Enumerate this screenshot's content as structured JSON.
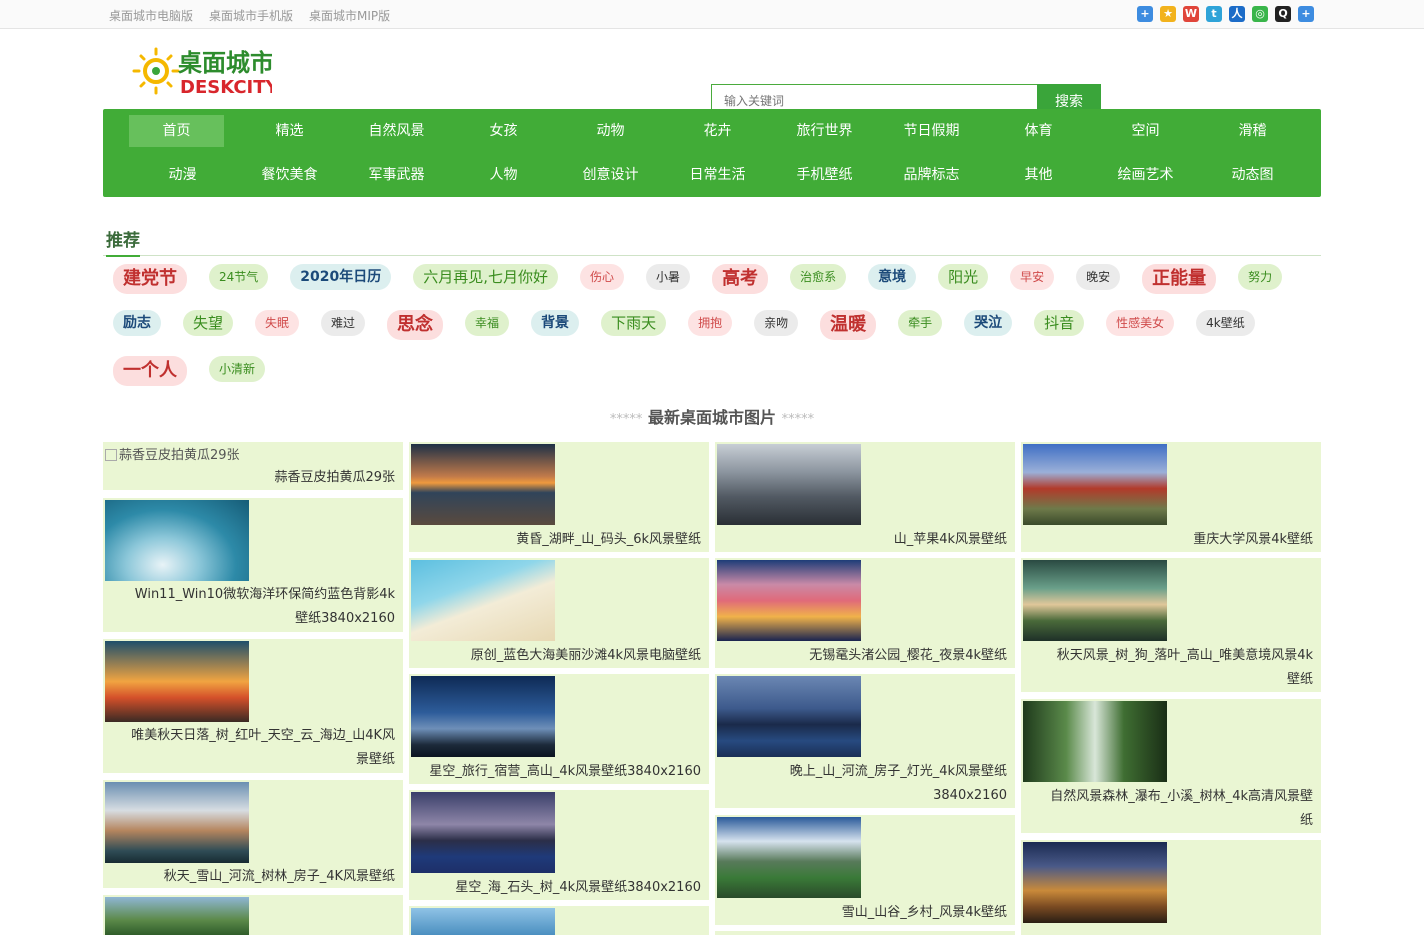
{
  "topbar": {
    "links": [
      "桌面城市电脑版",
      "桌面城市手机版",
      "桌面城市MIP版"
    ],
    "share_icons": [
      "plus-share-icon",
      "qzone-icon",
      "weibo-icon",
      "tencent-weibo-icon",
      "renren-icon",
      "wechat-icon",
      "qq-icon",
      "more-share-icon"
    ]
  },
  "logo": {
    "text_top": "桌面城市",
    "text_bottom": "DESKCITY"
  },
  "search": {
    "placeholder": "输入关键词",
    "button": "搜索"
  },
  "nav": {
    "row1": [
      "首页",
      "精选",
      "自然风景",
      "女孩",
      "动物",
      "花卉",
      "旅行世界",
      "节日假期",
      "体育",
      "空间",
      "滑稽"
    ],
    "row2": [
      "动漫",
      "餐饮美食",
      "军事武器",
      "人物",
      "创意设计",
      "日常生活",
      "手机壁纸",
      "品牌标志",
      "其他",
      "绘画艺术",
      "动态图"
    ]
  },
  "recommend": {
    "title": "推荐",
    "tags": [
      {
        "text": "建党节",
        "style": "t-red t-lg"
      },
      {
        "text": "24节气",
        "style": "t-green t-sm"
      },
      {
        "text": "2020年日历",
        "style": "t-blue t-md"
      },
      {
        "text": "六月再见,七月你好",
        "style": "t-green t-mdn"
      },
      {
        "text": "伤心",
        "style": "t-pink t-sm"
      },
      {
        "text": "小暑",
        "style": "t-grey t-sm"
      },
      {
        "text": "高考",
        "style": "t-red t-lg"
      },
      {
        "text": "治愈系",
        "style": "t-green t-sm"
      },
      {
        "text": "意境",
        "style": "t-blue t-md"
      },
      {
        "text": "阳光",
        "style": "t-green t-mdn"
      },
      {
        "text": "早安",
        "style": "t-pink t-sm"
      },
      {
        "text": "晚安",
        "style": "t-grey t-sm"
      },
      {
        "text": "正能量",
        "style": "t-red t-lg"
      },
      {
        "text": "努力",
        "style": "t-green t-sm"
      },
      {
        "text": "励志",
        "style": "t-blue t-md"
      },
      {
        "text": "失望",
        "style": "t-green t-mdn"
      },
      {
        "text": "失眠",
        "style": "t-pink t-sm"
      },
      {
        "text": "难过",
        "style": "t-grey t-sm"
      },
      {
        "text": "思念",
        "style": "t-red t-lg"
      },
      {
        "text": "幸福",
        "style": "t-green t-sm"
      },
      {
        "text": "背景",
        "style": "t-blue t-md"
      },
      {
        "text": "下雨天",
        "style": "t-green t-mdn"
      },
      {
        "text": "拥抱",
        "style": "t-pink t-sm"
      },
      {
        "text": "亲吻",
        "style": "t-grey t-sm"
      },
      {
        "text": "温暖",
        "style": "t-red t-lg"
      },
      {
        "text": "牵手",
        "style": "t-green t-sm"
      },
      {
        "text": "哭泣",
        "style": "t-blue t-md"
      },
      {
        "text": "抖音",
        "style": "t-green t-mdn"
      },
      {
        "text": "性感美女",
        "style": "t-pink t-sm"
      },
      {
        "text": "4k壁纸",
        "style": "t-grey t-sm"
      },
      {
        "text": "一个人",
        "style": "t-red t-lg"
      },
      {
        "text": "小清新",
        "style": "t-green t-sm"
      }
    ]
  },
  "latest": {
    "stars": "*****",
    "title": "最新桌面城市图片"
  },
  "cards": {
    "c0": {
      "caption": "蒜香豆皮拍黄瓜29张",
      "alt": "蒜香豆皮拍黄瓜29张"
    },
    "c1": {
      "caption1": "Win11_Win10微软海洋环保简约蓝色背影4k",
      "caption2": "壁纸3840x2160"
    },
    "c2": {
      "caption1": "唯美秋天日落_树_红叶_天空_云_海边_山4K风",
      "caption2": "景壁纸"
    },
    "c3": {
      "caption": "秋天_雪山_河流_树林_房子_4K风景壁纸"
    },
    "c4": {
      "caption": "黄昏_湖畔_山_码头_6k风景壁纸"
    },
    "c5": {
      "caption": "原创_蓝色大海美丽沙滩4k风景电脑壁纸"
    },
    "c6": {
      "caption": "星空_旅行_宿营_高山_4k风景壁纸3840x2160"
    },
    "c7": {
      "caption": "星空_海_石头_树_4k风景壁纸3840x2160"
    },
    "c8": {
      "caption": "山_苹果4k风景壁纸"
    },
    "c9": {
      "caption": "无锡鼋头渚公园_樱花_夜景4k壁纸"
    },
    "c10": {
      "caption1": "晚上_山_河流_房子_灯光_4k风景壁纸",
      "caption2": "3840x2160"
    },
    "c11": {
      "caption": "雪山_山谷_乡村_风景4k壁纸"
    },
    "c12": {
      "caption": "重庆大学风景4k壁纸"
    },
    "c13": {
      "caption1": "秋天风景_树_狗_落叶_高山_唯美意境风景4k",
      "caption2": "壁纸"
    },
    "c14": {
      "caption1": "自然风景森林_瀑布_小溪_树林_4k高清风景壁",
      "caption2": "纸"
    }
  }
}
